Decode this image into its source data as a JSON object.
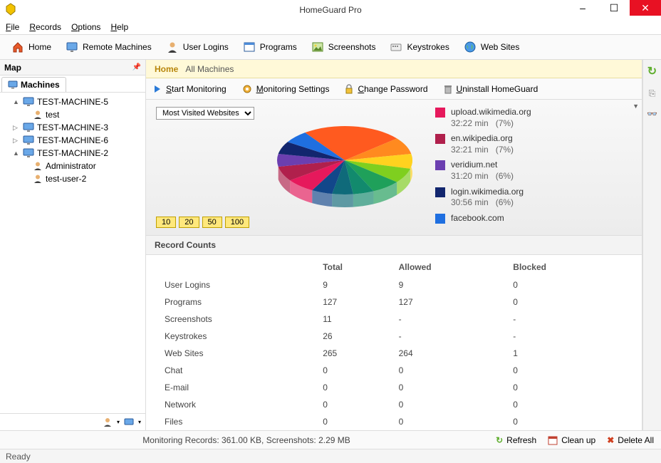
{
  "title": "HomeGuard Pro",
  "menu": [
    "File",
    "Records",
    "Options",
    "Help"
  ],
  "toolbar": [
    {
      "label": "Home",
      "icon": "home"
    },
    {
      "label": "Remote Machines",
      "icon": "monitor"
    },
    {
      "label": "User Logins",
      "icon": "user"
    },
    {
      "label": "Programs",
      "icon": "window"
    },
    {
      "label": "Screenshots",
      "icon": "image"
    },
    {
      "label": "Keystrokes",
      "icon": "keyboard"
    },
    {
      "label": "Web Sites",
      "icon": "globe"
    }
  ],
  "sidebar": {
    "header": "Map",
    "tab": "Machines",
    "tree": [
      {
        "exp": "▲",
        "type": "machine",
        "label": "TEST-MACHINE-5",
        "children": [
          {
            "type": "user",
            "label": "test"
          }
        ]
      },
      {
        "exp": "▷",
        "type": "machine",
        "label": "TEST-MACHINE-3"
      },
      {
        "exp": "▷",
        "type": "machine",
        "label": "TEST-MACHINE-6"
      },
      {
        "exp": "▲",
        "type": "machine",
        "label": "TEST-MACHINE-2",
        "children": [
          {
            "type": "user",
            "label": "Administrator"
          },
          {
            "type": "user",
            "label": "test-user-2"
          }
        ]
      }
    ]
  },
  "breadcrumb": {
    "home": "Home",
    "rest": "All Machines"
  },
  "actions": [
    {
      "icon": "play",
      "label": "Start Monitoring"
    },
    {
      "icon": "gear",
      "label": "Monitoring Settings"
    },
    {
      "icon": "lock",
      "label": "Change Password"
    },
    {
      "icon": "trash",
      "label": "Uninstall HomeGuard"
    }
  ],
  "chart_dropdown": "Most Visited Websites",
  "page_buttons": [
    "10",
    "20",
    "50",
    "100"
  ],
  "chart_data": {
    "type": "pie",
    "title": "Most Visited Websites",
    "series": [
      {
        "name": "upload.wikimedia.org",
        "time": "32:22 min",
        "pct": 7,
        "color": "#e6195c"
      },
      {
        "name": "en.wikipedia.org",
        "time": "32:21 min",
        "pct": 7,
        "color": "#b0204c"
      },
      {
        "name": "veridium.net",
        "time": "31:20 min",
        "pct": 6,
        "color": "#6b3fb0"
      },
      {
        "name": "login.wikimedia.org",
        "time": "30:56 min",
        "pct": 6,
        "color": "#12266e"
      },
      {
        "name": "facebook.com",
        "time": "",
        "pct": 6,
        "color": "#1f6fe0"
      }
    ],
    "other_slices": [
      {
        "color": "#ff5a1f",
        "pct": 24
      },
      {
        "color": "#ff8a1f",
        "pct": 8
      },
      {
        "color": "#ffd21f",
        "pct": 7
      },
      {
        "color": "#7fcf1f",
        "pct": 7
      },
      {
        "color": "#1fa05a",
        "pct": 7
      },
      {
        "color": "#128a6d",
        "pct": 5
      },
      {
        "color": "#0f6a7a",
        "pct": 5
      },
      {
        "color": "#12478a",
        "pct": 5
      }
    ]
  },
  "records_header": "Record Counts",
  "records_cols": [
    "",
    "Total",
    "Allowed",
    "Blocked"
  ],
  "records": [
    {
      "name": "User Logins",
      "total": "9",
      "allowed": "9",
      "blocked": "0"
    },
    {
      "name": "Programs",
      "total": "127",
      "allowed": "127",
      "blocked": "0"
    },
    {
      "name": "Screenshots",
      "total": "11",
      "allowed": "-",
      "blocked": "-"
    },
    {
      "name": "Keystrokes",
      "total": "26",
      "allowed": "-",
      "blocked": "-"
    },
    {
      "name": "Web Sites",
      "total": "265",
      "allowed": "264",
      "blocked": "1"
    },
    {
      "name": "Chat",
      "total": "0",
      "allowed": "0",
      "blocked": "0"
    },
    {
      "name": "E-mail",
      "total": "0",
      "allowed": "0",
      "blocked": "0"
    },
    {
      "name": "Network",
      "total": "0",
      "allowed": "0",
      "blocked": "0"
    },
    {
      "name": "Files",
      "total": "0",
      "allowed": "0",
      "blocked": "0"
    }
  ],
  "status_mid": "Monitoring Records: 361.00 KB, Screenshots: 2.29 MB",
  "status_btns": [
    {
      "icon": "refresh",
      "label": "Refresh"
    },
    {
      "icon": "calendar",
      "label": "Clean up"
    },
    {
      "icon": "delete",
      "label": "Delete All"
    }
  ],
  "ready": "Ready"
}
